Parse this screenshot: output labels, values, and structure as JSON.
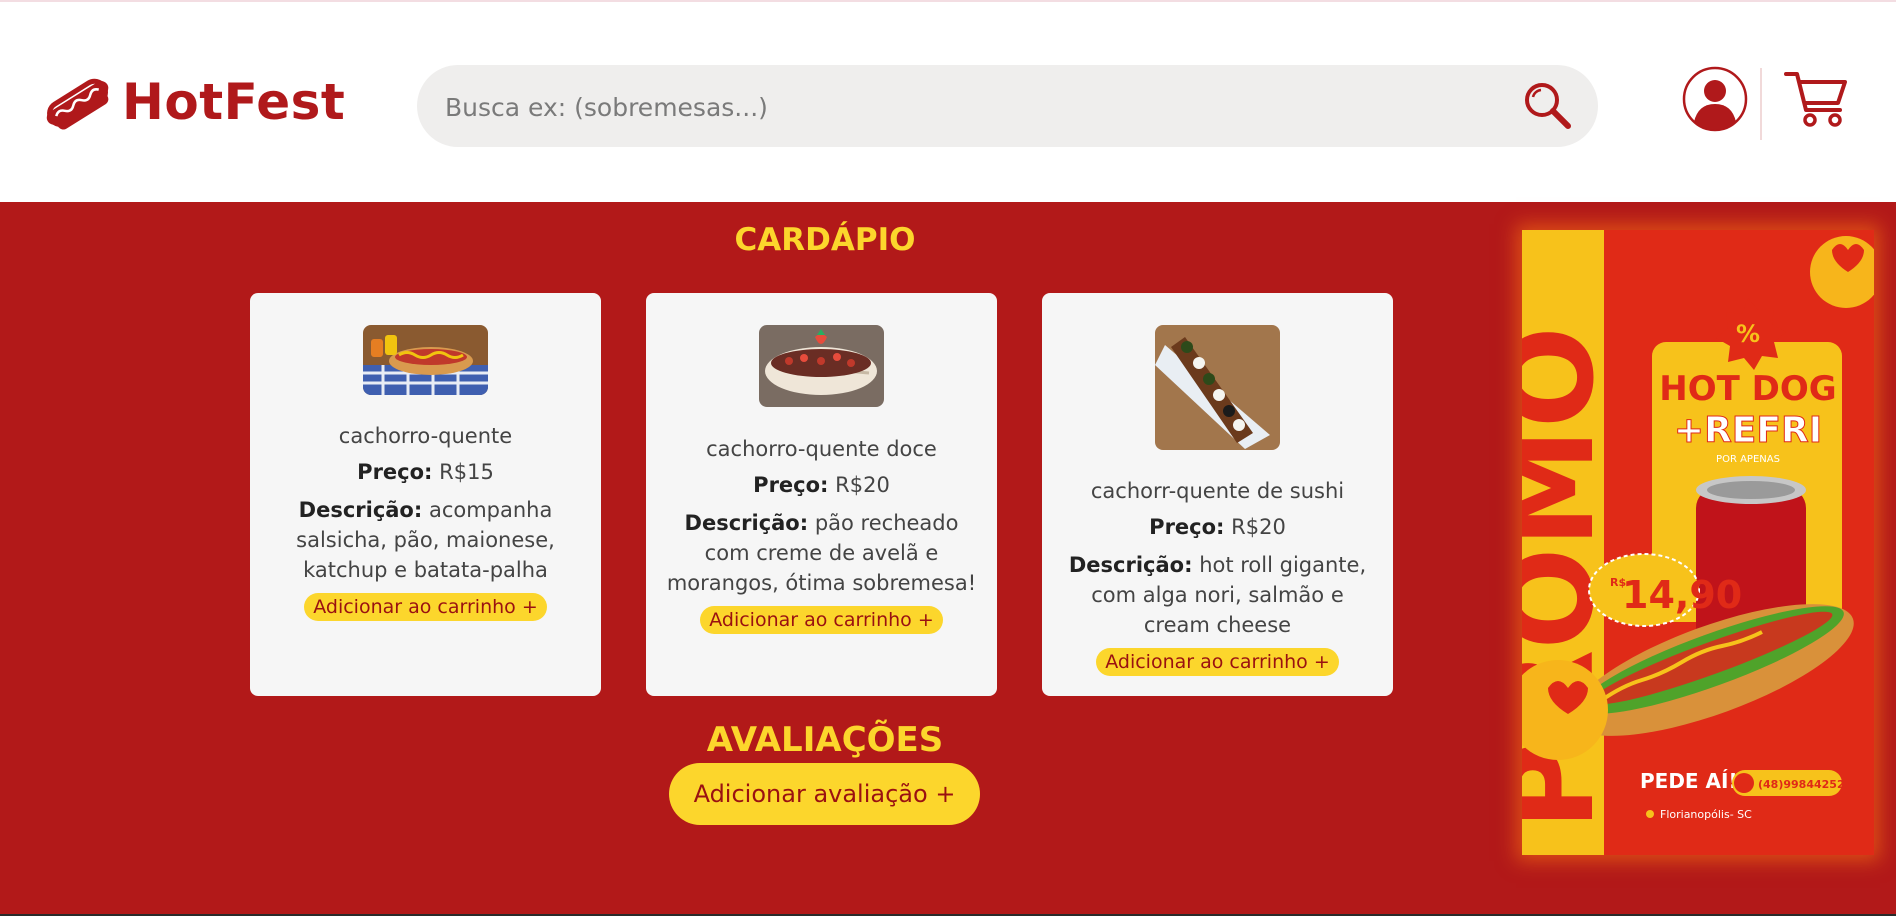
{
  "brand": {
    "name": "HotFest"
  },
  "search": {
    "placeholder": "Busca ex: (sobremesas...)"
  },
  "icons": {
    "logo": "hot-dog-icon",
    "search": "search-icon",
    "user": "user-icon",
    "cart": "cart-icon"
  },
  "menu": {
    "title": "CARDÁPIO",
    "price_label": "Preço:",
    "desc_label": "Descrição:",
    "add_label": "Adicionar ao carrinho +",
    "items": [
      {
        "name": "cachorro-quente",
        "price": "R$15",
        "description": "acompanha salsicha, pão, maionese, katchup e batata-palha"
      },
      {
        "name": "cachorro-quente doce",
        "price": "R$20",
        "description": "pão recheado com creme de avelã e morangos, ótima sobremesa!"
      },
      {
        "name": "cachorr-quente de sushi",
        "price": "R$20",
        "description": "hot roll gigante, com alga nori, salmão e cream cheese"
      }
    ]
  },
  "reviews": {
    "title": "AVALIAÇÕES",
    "add_label": "Adicionar avaliação +"
  },
  "promo": {
    "vertical_text": "PROMO",
    "line1": "HOT DOG",
    "line2": "+REFRI",
    "sub": "POR APENAS",
    "currency": "R$",
    "price": "14,90",
    "cta": "PEDE AÍ!",
    "phone": "(48)99844252",
    "location": "Florianopólis- SC"
  },
  "colors": {
    "brand_red": "#b0191b",
    "main_bg": "#b21919",
    "accent_yellow": "#fcd62c",
    "card_bg": "#f6f6f6",
    "search_bg": "#efeeed"
  }
}
